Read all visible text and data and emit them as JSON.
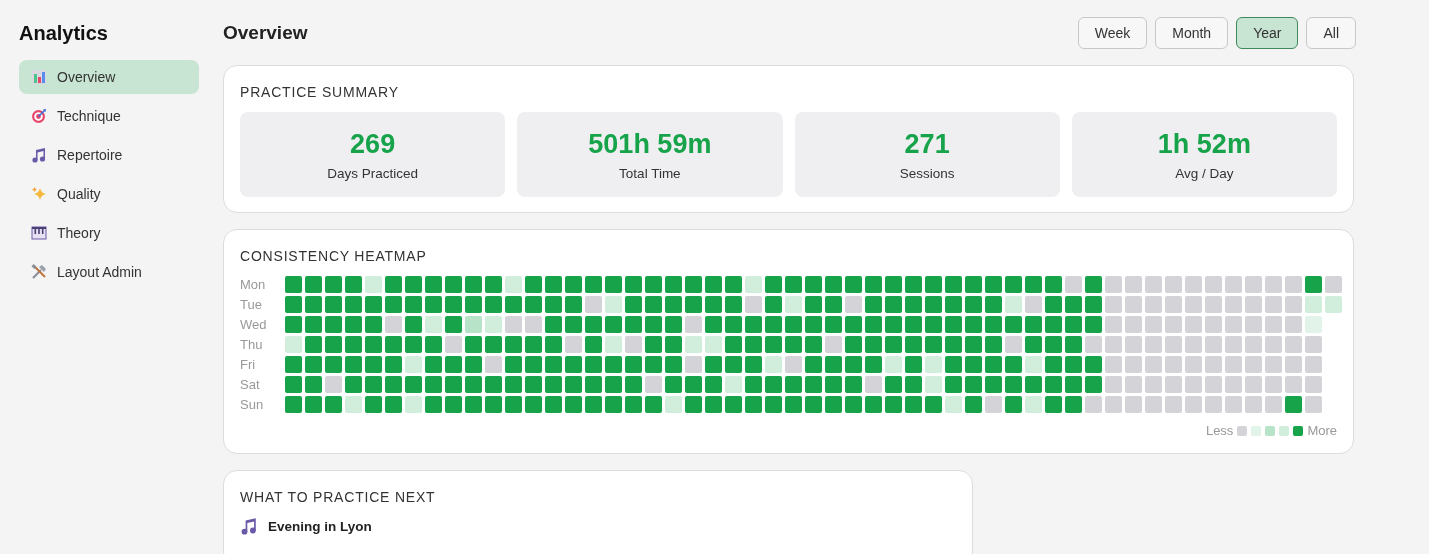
{
  "sidebar": {
    "title": "Analytics",
    "items": [
      {
        "label": "Overview",
        "kind": "chart",
        "selected": true
      },
      {
        "label": "Technique",
        "kind": "target",
        "selected": false
      },
      {
        "label": "Repertoire",
        "kind": "note",
        "selected": false
      },
      {
        "label": "Quality",
        "kind": "sparkle",
        "selected": false
      },
      {
        "label": "Theory",
        "kind": "piano",
        "selected": false
      },
      {
        "label": "Layout Admin",
        "kind": "tools",
        "selected": false
      }
    ]
  },
  "header": {
    "title": "Overview",
    "ranges": [
      {
        "label": "Week",
        "selected": false
      },
      {
        "label": "Month",
        "selected": false
      },
      {
        "label": "Year",
        "selected": true
      },
      {
        "label": "All",
        "selected": false
      }
    ]
  },
  "summary": {
    "title": "PRACTICE SUMMARY",
    "stats": [
      {
        "value": "269",
        "label": "Days Practiced"
      },
      {
        "value": "501h 59m",
        "label": "Total Time"
      },
      {
        "value": "271",
        "label": "Sessions"
      },
      {
        "value": "1h 52m",
        "label": "Avg / Day"
      }
    ]
  },
  "heatmap": {
    "title": "CONSISTENCY HEATMAP",
    "rows": [
      {
        "day": "Mon",
        "cells": [
          {
            "color": "#16a34a"
          },
          {
            "color": "#16a34a"
          },
          {
            "color": "#16a34a"
          },
          {
            "color": "#16a34a"
          },
          {
            "color": "#d1eddb"
          },
          {
            "color": "#16a34a"
          },
          {
            "color": "#16a34a"
          },
          {
            "color": "#16a34a"
          },
          {
            "color": "#16a34a"
          },
          {
            "color": "#16a34a"
          },
          {
            "color": "#16a34a"
          },
          {
            "color": "#d1eddb"
          },
          {
            "color": "#16a34a"
          },
          {
            "color": "#16a34a"
          },
          {
            "color": "#16a34a"
          },
          {
            "color": "#16a34a"
          },
          {
            "color": "#16a34a"
          },
          {
            "color": "#16a34a"
          },
          {
            "color": "#16a34a"
          },
          {
            "color": "#16a34a"
          },
          {
            "color": "#16a34a"
          },
          {
            "color": "#16a34a"
          },
          {
            "color": "#16a34a"
          },
          {
            "color": "#d1eddb"
          },
          {
            "color": "#16a34a"
          },
          {
            "color": "#16a34a"
          },
          {
            "color": "#16a34a"
          },
          {
            "color": "#16a34a"
          },
          {
            "color": "#16a34a"
          },
          {
            "color": "#16a34a"
          },
          {
            "color": "#16a34a"
          },
          {
            "color": "#16a34a"
          },
          {
            "color": "#16a34a"
          },
          {
            "color": "#16a34a"
          },
          {
            "color": "#16a34a"
          },
          {
            "color": "#16a34a"
          },
          {
            "color": "#16a34a"
          },
          {
            "color": "#16a34a"
          },
          {
            "color": "#16a34a"
          },
          {
            "color": "#d4d4d8"
          },
          {
            "color": "#16a34a"
          },
          {
            "color": "#d4d4d8"
          },
          {
            "color": "#d4d4d8"
          },
          {
            "color": "#d4d4d8"
          },
          {
            "color": "#d4d4d8"
          },
          {
            "color": "#d4d4d8"
          },
          {
            "color": "#d4d4d8"
          },
          {
            "color": "#d4d4d8"
          },
          {
            "color": "#d4d4d8"
          },
          {
            "color": "#d4d4d8"
          },
          {
            "color": "#d4d4d8"
          },
          {
            "color": "#16a34a"
          },
          {
            "color": "#d4d4d8"
          }
        ]
      },
      {
        "day": "Tue",
        "cells": [
          {
            "color": "#16a34a"
          },
          {
            "color": "#16a34a"
          },
          {
            "color": "#16a34a"
          },
          {
            "color": "#16a34a"
          },
          {
            "color": "#16a34a"
          },
          {
            "color": "#16a34a"
          },
          {
            "color": "#16a34a"
          },
          {
            "color": "#16a34a"
          },
          {
            "color": "#16a34a"
          },
          {
            "color": "#16a34a"
          },
          {
            "color": "#16a34a"
          },
          {
            "color": "#16a34a"
          },
          {
            "color": "#16a34a"
          },
          {
            "color": "#16a34a"
          },
          {
            "color": "#16a34a"
          },
          {
            "color": "#d4d4d8"
          },
          {
            "color": "#d1eddb"
          },
          {
            "color": "#16a34a"
          },
          {
            "color": "#16a34a"
          },
          {
            "color": "#16a34a"
          },
          {
            "color": "#16a34a"
          },
          {
            "color": "#16a34a"
          },
          {
            "color": "#16a34a"
          },
          {
            "color": "#d4d4d8"
          },
          {
            "color": "#16a34a"
          },
          {
            "color": "#d1eddb"
          },
          {
            "color": "#16a34a"
          },
          {
            "color": "#16a34a"
          },
          {
            "color": "#d4d4d8"
          },
          {
            "color": "#16a34a"
          },
          {
            "color": "#16a34a"
          },
          {
            "color": "#16a34a"
          },
          {
            "color": "#16a34a"
          },
          {
            "color": "#16a34a"
          },
          {
            "color": "#16a34a"
          },
          {
            "color": "#16a34a"
          },
          {
            "color": "#d1eddb"
          },
          {
            "color": "#d4d4d8"
          },
          {
            "color": "#16a34a"
          },
          {
            "color": "#16a34a"
          },
          {
            "color": "#16a34a"
          },
          {
            "color": "#d4d4d8"
          },
          {
            "color": "#d4d4d8"
          },
          {
            "color": "#d4d4d8"
          },
          {
            "color": "#d4d4d8"
          },
          {
            "color": "#d4d4d8"
          },
          {
            "color": "#d4d4d8"
          },
          {
            "color": "#d4d4d8"
          },
          {
            "color": "#d4d4d8"
          },
          {
            "color": "#d4d4d8"
          },
          {
            "color": "#d4d4d8"
          },
          {
            "color": "#d1eddb"
          },
          {
            "color": "#d1eddb"
          }
        ]
      },
      {
        "day": "Wed",
        "cells": [
          {
            "color": "#16a34a"
          },
          {
            "color": "#16a34a"
          },
          {
            "color": "#16a34a"
          },
          {
            "color": "#16a34a"
          },
          {
            "color": "#16a34a"
          },
          {
            "color": "#d4d4d8"
          },
          {
            "color": "#16a34a"
          },
          {
            "color": "#d1eddb"
          },
          {
            "color": "#16a34a"
          },
          {
            "color": "#b7e3c8"
          },
          {
            "color": "#d1eddb"
          },
          {
            "color": "#d4d4d8"
          },
          {
            "color": "#d4d4d8"
          },
          {
            "color": "#16a34a"
          },
          {
            "color": "#16a34a"
          },
          {
            "color": "#16a34a"
          },
          {
            "color": "#16a34a"
          },
          {
            "color": "#16a34a"
          },
          {
            "color": "#16a34a"
          },
          {
            "color": "#16a34a"
          },
          {
            "color": "#d4d4d8"
          },
          {
            "color": "#16a34a"
          },
          {
            "color": "#16a34a"
          },
          {
            "color": "#16a34a"
          },
          {
            "color": "#16a34a"
          },
          {
            "color": "#16a34a"
          },
          {
            "color": "#16a34a"
          },
          {
            "color": "#16a34a"
          },
          {
            "color": "#16a34a"
          },
          {
            "color": "#16a34a"
          },
          {
            "color": "#16a34a"
          },
          {
            "color": "#16a34a"
          },
          {
            "color": "#16a34a"
          },
          {
            "color": "#16a34a"
          },
          {
            "color": "#16a34a"
          },
          {
            "color": "#16a34a"
          },
          {
            "color": "#16a34a"
          },
          {
            "color": "#16a34a"
          },
          {
            "color": "#16a34a"
          },
          {
            "color": "#16a34a"
          },
          {
            "color": "#16a34a"
          },
          {
            "color": "#d4d4d8"
          },
          {
            "color": "#d4d4d8"
          },
          {
            "color": "#d4d4d8"
          },
          {
            "color": "#d4d4d8"
          },
          {
            "color": "#d4d4d8"
          },
          {
            "color": "#d4d4d8"
          },
          {
            "color": "#d4d4d8"
          },
          {
            "color": "#d4d4d8"
          },
          {
            "color": "#d4d4d8"
          },
          {
            "color": "#d4d4d8"
          },
          {
            "color": "#e2f4e9"
          }
        ]
      },
      {
        "day": "Thu",
        "cells": [
          {
            "color": "#d1eddb"
          },
          {
            "color": "#16a34a"
          },
          {
            "color": "#16a34a"
          },
          {
            "color": "#16a34a"
          },
          {
            "color": "#16a34a"
          },
          {
            "color": "#16a34a"
          },
          {
            "color": "#16a34a"
          },
          {
            "color": "#16a34a"
          },
          {
            "color": "#d4d4d8"
          },
          {
            "color": "#16a34a"
          },
          {
            "color": "#16a34a"
          },
          {
            "color": "#16a34a"
          },
          {
            "color": "#16a34a"
          },
          {
            "color": "#16a34a"
          },
          {
            "color": "#d4d4d8"
          },
          {
            "color": "#16a34a"
          },
          {
            "color": "#d1eddb"
          },
          {
            "color": "#d4d4d8"
          },
          {
            "color": "#16a34a"
          },
          {
            "color": "#16a34a"
          },
          {
            "color": "#d1eddb"
          },
          {
            "color": "#d1eddb"
          },
          {
            "color": "#16a34a"
          },
          {
            "color": "#16a34a"
          },
          {
            "color": "#16a34a"
          },
          {
            "color": "#16a34a"
          },
          {
            "color": "#16a34a"
          },
          {
            "color": "#d4d4d8"
          },
          {
            "color": "#16a34a"
          },
          {
            "color": "#16a34a"
          },
          {
            "color": "#16a34a"
          },
          {
            "color": "#16a34a"
          },
          {
            "color": "#16a34a"
          },
          {
            "color": "#16a34a"
          },
          {
            "color": "#16a34a"
          },
          {
            "color": "#16a34a"
          },
          {
            "color": "#d4d4d8"
          },
          {
            "color": "#16a34a"
          },
          {
            "color": "#16a34a"
          },
          {
            "color": "#16a34a"
          },
          {
            "color": "#d4d4d8"
          },
          {
            "color": "#d4d4d8"
          },
          {
            "color": "#d4d4d8"
          },
          {
            "color": "#d4d4d8"
          },
          {
            "color": "#d4d4d8"
          },
          {
            "color": "#d4d4d8"
          },
          {
            "color": "#d4d4d8"
          },
          {
            "color": "#d4d4d8"
          },
          {
            "color": "#d4d4d8"
          },
          {
            "color": "#d4d4d8"
          },
          {
            "color": "#d4d4d8"
          },
          {
            "color": "#d4d4d8"
          }
        ]
      },
      {
        "day": "Fri",
        "cells": [
          {
            "color": "#16a34a"
          },
          {
            "color": "#16a34a"
          },
          {
            "color": "#16a34a"
          },
          {
            "color": "#16a34a"
          },
          {
            "color": "#16a34a"
          },
          {
            "color": "#16a34a"
          },
          {
            "color": "#d1eddb"
          },
          {
            "color": "#16a34a"
          },
          {
            "color": "#16a34a"
          },
          {
            "color": "#16a34a"
          },
          {
            "color": "#d4d4d8"
          },
          {
            "color": "#16a34a"
          },
          {
            "color": "#16a34a"
          },
          {
            "color": "#16a34a"
          },
          {
            "color": "#16a34a"
          },
          {
            "color": "#16a34a"
          },
          {
            "color": "#16a34a"
          },
          {
            "color": "#16a34a"
          },
          {
            "color": "#16a34a"
          },
          {
            "color": "#16a34a"
          },
          {
            "color": "#d4d4d8"
          },
          {
            "color": "#16a34a"
          },
          {
            "color": "#16a34a"
          },
          {
            "color": "#16a34a"
          },
          {
            "color": "#d1eddb"
          },
          {
            "color": "#d4d4d8"
          },
          {
            "color": "#16a34a"
          },
          {
            "color": "#16a34a"
          },
          {
            "color": "#16a34a"
          },
          {
            "color": "#16a34a"
          },
          {
            "color": "#d1eddb"
          },
          {
            "color": "#16a34a"
          },
          {
            "color": "#d1eddb"
          },
          {
            "color": "#16a34a"
          },
          {
            "color": "#16a34a"
          },
          {
            "color": "#16a34a"
          },
          {
            "color": "#16a34a"
          },
          {
            "color": "#d1eddb"
          },
          {
            "color": "#16a34a"
          },
          {
            "color": "#16a34a"
          },
          {
            "color": "#16a34a"
          },
          {
            "color": "#d4d4d8"
          },
          {
            "color": "#d4d4d8"
          },
          {
            "color": "#d4d4d8"
          },
          {
            "color": "#d4d4d8"
          },
          {
            "color": "#d4d4d8"
          },
          {
            "color": "#d4d4d8"
          },
          {
            "color": "#d4d4d8"
          },
          {
            "color": "#d4d4d8"
          },
          {
            "color": "#d4d4d8"
          },
          {
            "color": "#d4d4d8"
          },
          {
            "color": "#d4d4d8"
          }
        ]
      },
      {
        "day": "Sat",
        "cells": [
          {
            "color": "#16a34a"
          },
          {
            "color": "#16a34a"
          },
          {
            "color": "#d4d4d8"
          },
          {
            "color": "#16a34a"
          },
          {
            "color": "#16a34a"
          },
          {
            "color": "#16a34a"
          },
          {
            "color": "#16a34a"
          },
          {
            "color": "#16a34a"
          },
          {
            "color": "#16a34a"
          },
          {
            "color": "#16a34a"
          },
          {
            "color": "#16a34a"
          },
          {
            "color": "#16a34a"
          },
          {
            "color": "#16a34a"
          },
          {
            "color": "#16a34a"
          },
          {
            "color": "#16a34a"
          },
          {
            "color": "#16a34a"
          },
          {
            "color": "#16a34a"
          },
          {
            "color": "#16a34a"
          },
          {
            "color": "#d4d4d8"
          },
          {
            "color": "#16a34a"
          },
          {
            "color": "#16a34a"
          },
          {
            "color": "#16a34a"
          },
          {
            "color": "#d1eddb"
          },
          {
            "color": "#16a34a"
          },
          {
            "color": "#16a34a"
          },
          {
            "color": "#16a34a"
          },
          {
            "color": "#16a34a"
          },
          {
            "color": "#16a34a"
          },
          {
            "color": "#16a34a"
          },
          {
            "color": "#d4d4d8"
          },
          {
            "color": "#16a34a"
          },
          {
            "color": "#16a34a"
          },
          {
            "color": "#d1eddb"
          },
          {
            "color": "#16a34a"
          },
          {
            "color": "#16a34a"
          },
          {
            "color": "#16a34a"
          },
          {
            "color": "#16a34a"
          },
          {
            "color": "#16a34a"
          },
          {
            "color": "#16a34a"
          },
          {
            "color": "#16a34a"
          },
          {
            "color": "#16a34a"
          },
          {
            "color": "#d4d4d8"
          },
          {
            "color": "#d4d4d8"
          },
          {
            "color": "#d4d4d8"
          },
          {
            "color": "#d4d4d8"
          },
          {
            "color": "#d4d4d8"
          },
          {
            "color": "#d4d4d8"
          },
          {
            "color": "#d4d4d8"
          },
          {
            "color": "#d4d4d8"
          },
          {
            "color": "#d4d4d8"
          },
          {
            "color": "#d4d4d8"
          },
          {
            "color": "#d4d4d8"
          }
        ]
      },
      {
        "day": "Sun",
        "cells": [
          {
            "color": "#16a34a"
          },
          {
            "color": "#16a34a"
          },
          {
            "color": "#16a34a"
          },
          {
            "color": "#d1eddb"
          },
          {
            "color": "#16a34a"
          },
          {
            "color": "#16a34a"
          },
          {
            "color": "#d1eddb"
          },
          {
            "color": "#16a34a"
          },
          {
            "color": "#16a34a"
          },
          {
            "color": "#16a34a"
          },
          {
            "color": "#16a34a"
          },
          {
            "color": "#16a34a"
          },
          {
            "color": "#16a34a"
          },
          {
            "color": "#16a34a"
          },
          {
            "color": "#16a34a"
          },
          {
            "color": "#16a34a"
          },
          {
            "color": "#16a34a"
          },
          {
            "color": "#16a34a"
          },
          {
            "color": "#16a34a"
          },
          {
            "color": "#d1eddb"
          },
          {
            "color": "#16a34a"
          },
          {
            "color": "#16a34a"
          },
          {
            "color": "#16a34a"
          },
          {
            "color": "#16a34a"
          },
          {
            "color": "#16a34a"
          },
          {
            "color": "#16a34a"
          },
          {
            "color": "#16a34a"
          },
          {
            "color": "#16a34a"
          },
          {
            "color": "#16a34a"
          },
          {
            "color": "#16a34a"
          },
          {
            "color": "#16a34a"
          },
          {
            "color": "#16a34a"
          },
          {
            "color": "#16a34a"
          },
          {
            "color": "#d1eddb"
          },
          {
            "color": "#16a34a"
          },
          {
            "color": "#d4d4d8"
          },
          {
            "color": "#16a34a"
          },
          {
            "color": "#d1eddb"
          },
          {
            "color": "#16a34a"
          },
          {
            "color": "#16a34a"
          },
          {
            "color": "#d4d4d8"
          },
          {
            "color": "#d4d4d8"
          },
          {
            "color": "#d4d4d8"
          },
          {
            "color": "#d4d4d8"
          },
          {
            "color": "#d4d4d8"
          },
          {
            "color": "#d4d4d8"
          },
          {
            "color": "#d4d4d8"
          },
          {
            "color": "#d4d4d8"
          },
          {
            "color": "#d4d4d8"
          },
          {
            "color": "#d4d4d8"
          },
          {
            "color": "#16a34a"
          },
          {
            "color": "#d4d4d8"
          }
        ]
      }
    ],
    "legend": {
      "less": "Less",
      "more": "More",
      "swatches": [
        {
          "color": "#d4d4d8"
        },
        {
          "color": "#e2f4e9"
        },
        {
          "color": "#b7e3c8"
        },
        {
          "color": "#d1eddb"
        },
        {
          "color": "#16a34a"
        }
      ]
    }
  },
  "next": {
    "title": "WHAT TO PRACTICE NEXT",
    "items": [
      {
        "label": "Evening in Lyon",
        "kind": "note"
      }
    ]
  }
}
